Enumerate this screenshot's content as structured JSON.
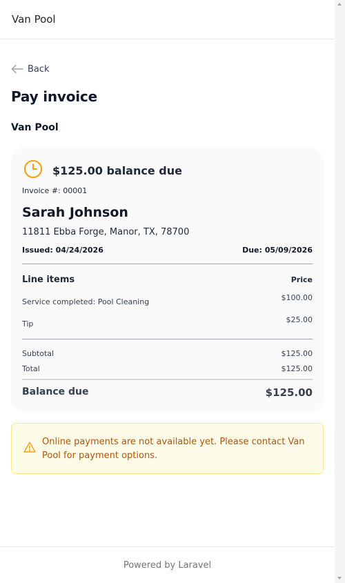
{
  "app": {
    "brand": "Van Pool"
  },
  "nav": {
    "back_label": "Back"
  },
  "page": {
    "title": "Pay invoice",
    "vendor_name": "Van Pool"
  },
  "invoice": {
    "balance_heading": "$125.00 balance due",
    "number_label": "Invoice #: 00001",
    "customer_name": "Sarah Johnson",
    "customer_address": "11811 Ebba Forge, Manor, TX, 78700",
    "issued": "Issued: 04/24/2026",
    "due_date": "Due: 05/09/2026",
    "line_items_header": "Line items",
    "price_header": "Price",
    "line_items": [
      {
        "description": "Service completed: Pool Cleaning",
        "price": "$100.00"
      },
      {
        "description": "Tip",
        "price": "$25.00"
      }
    ],
    "subtotal_label": "Subtotal",
    "subtotal": "$125.00",
    "total_label": "Total",
    "total": "$125.00",
    "balance_due_label": "Balance due",
    "balance_due": "$125.00"
  },
  "notice": {
    "message": "Online payments are not available yet. Please contact Van Pool for payment options."
  },
  "footer": {
    "text": "Powered by Laravel"
  },
  "colors": {
    "accent_orange": "#f59e0b",
    "notice_bg": "#fefce8",
    "notice_text": "#b45309",
    "card_bg": "#fafafa"
  },
  "icons": {
    "back": "arrow-left-icon",
    "balance": "clock-icon",
    "notice": "warning-triangle-icon"
  }
}
